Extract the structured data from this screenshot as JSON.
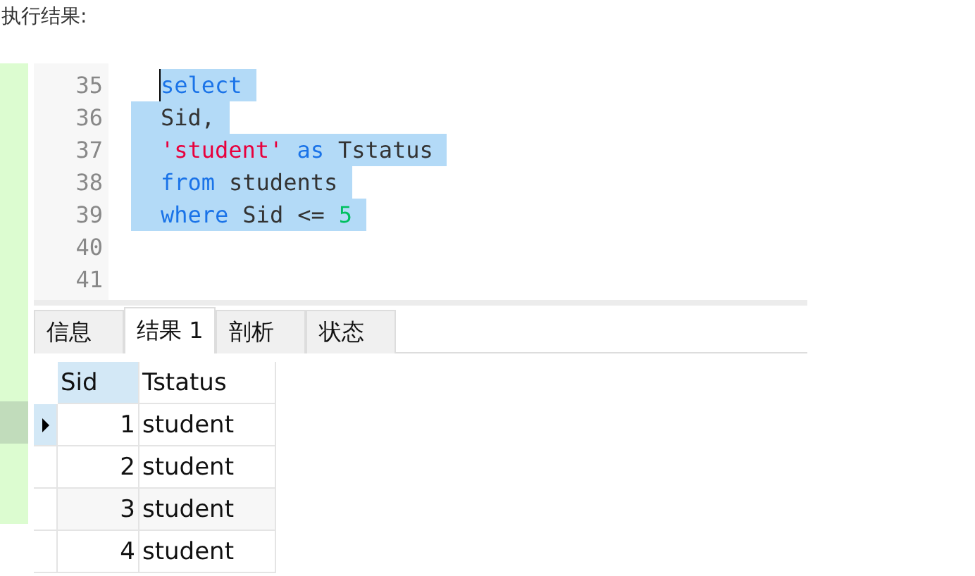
{
  "heading": "执行结果:",
  "editor": {
    "lines": [
      {
        "number": "35",
        "selected": true,
        "caret": true,
        "tokens": [
          {
            "kind": "keyword",
            "text": "select"
          }
        ]
      },
      {
        "number": "36",
        "selected": true,
        "caret": false,
        "tokens": [
          {
            "kind": "ident",
            "text": "Sid,"
          }
        ]
      },
      {
        "number": "37",
        "selected": true,
        "caret": false,
        "tokens": [
          {
            "kind": "string",
            "text": "'student'"
          },
          {
            "kind": "keyword",
            "text": "as"
          },
          {
            "kind": "ident",
            "text": "Tstatus"
          }
        ]
      },
      {
        "number": "38",
        "selected": true,
        "caret": false,
        "tokens": [
          {
            "kind": "keyword",
            "text": "from"
          },
          {
            "kind": "ident",
            "text": "students"
          }
        ]
      },
      {
        "number": "39",
        "selected": true,
        "caret": false,
        "tokens": [
          {
            "kind": "keyword",
            "text": "where"
          },
          {
            "kind": "ident",
            "text": "Sid"
          },
          {
            "kind": "ident",
            "text": "<="
          },
          {
            "kind": "number",
            "text": "5"
          }
        ]
      },
      {
        "number": "40"
      },
      {
        "number": "41"
      }
    ]
  },
  "tabs": [
    {
      "label": "信息",
      "selected": false
    },
    {
      "label": "结果 1",
      "selected": true
    },
    {
      "label": "剖析",
      "selected": false
    },
    {
      "label": "状态",
      "selected": false
    }
  ],
  "table": {
    "columns": [
      {
        "label": "Sid",
        "selected": true
      },
      {
        "label": "Tstatus",
        "selected": false
      }
    ],
    "rows": [
      {
        "cells": [
          "1",
          "student"
        ],
        "selected": true
      },
      {
        "cells": [
          "2",
          "student"
        ],
        "selected": false
      },
      {
        "cells": [
          "3",
          "student"
        ],
        "selected": false
      },
      {
        "cells": [
          "4",
          "student"
        ],
        "selected": false
      }
    ]
  }
}
